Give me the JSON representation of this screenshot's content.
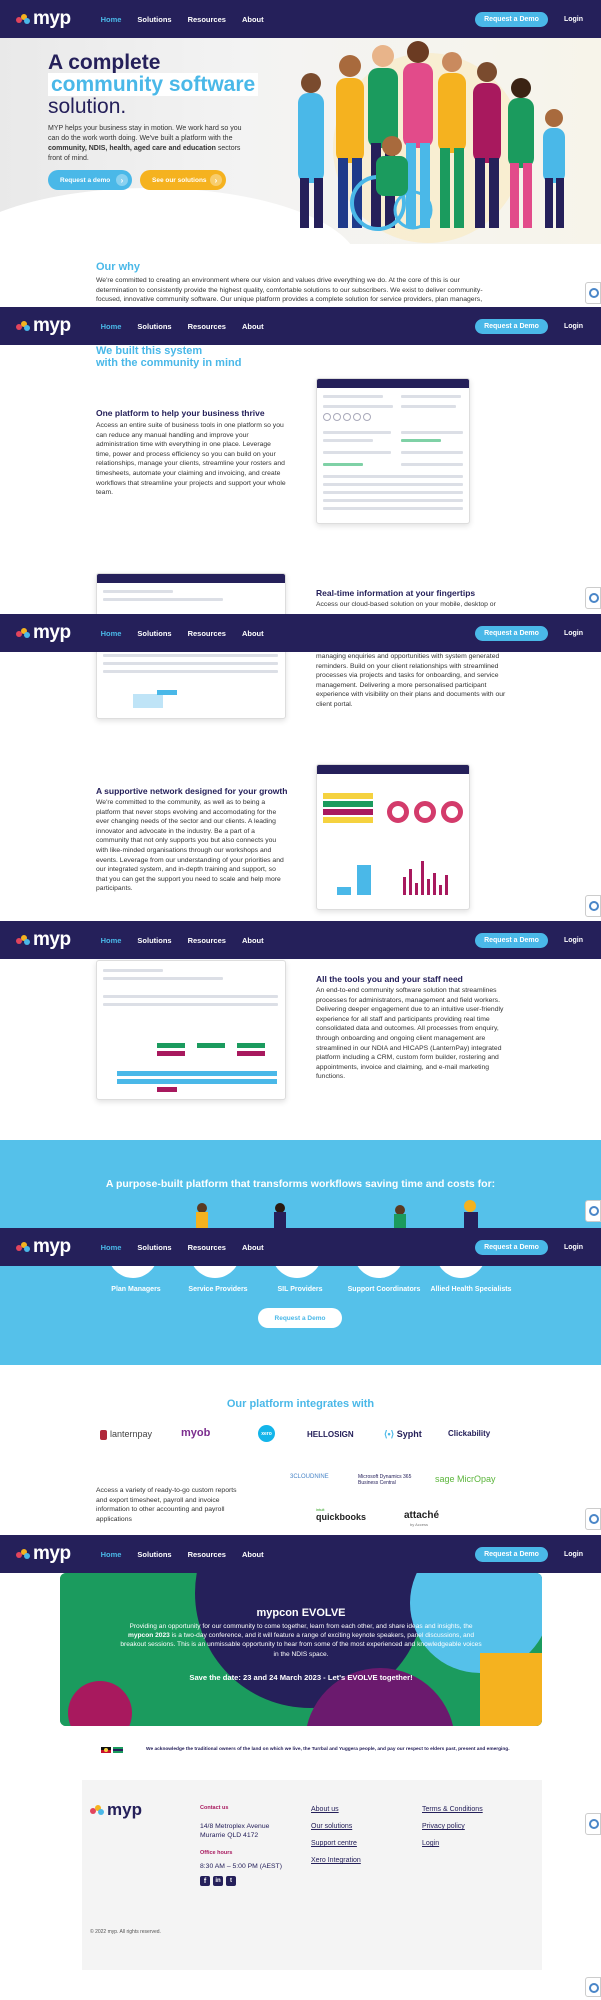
{
  "nav": {
    "brand": "myp",
    "links": [
      "Home",
      "Solutions",
      "Resources",
      "About"
    ],
    "demo_button": "Request a Demo",
    "login": "Login"
  },
  "hero": {
    "title_line1": "A complete",
    "title_highlight": "community software",
    "title_line3": "solution.",
    "desc_plain1": "MYP helps your business stay in motion. We work hard so you can do the work worth doing. We've built a platform with the ",
    "desc_bold": "community, NDIS, health, aged care and education",
    "desc_plain2": " sectors front of mind.",
    "btn_demo": "Request a demo",
    "btn_solutions": "See our solutions"
  },
  "why": {
    "title": "Our why",
    "text": "We're committed to creating an environment where our vision and values drive everything we do.  At the core of this is our determination to consistently provide the highest quality, comfortable solutions to our subscribers.  We exist to deliver community-focused, innovative community software.  Our unique platform provides a complete solution for service providers, plan managers,"
  },
  "built": {
    "title_line1": "We built this system",
    "title_line2": "with the community in mind"
  },
  "features": [
    {
      "title": "One platform to help your business thrive",
      "text": "Access an entire suite of business tools in one platform so you can reduce any manual handling and improve your administration time with everything in one place.  Leverage time, power and process efficiency so you can build on your relationships, manage your clients, streamline your rosters and timesheets, automate your claiming and invoicing, and create workflows that streamline your projects and support your whole team."
    },
    {
      "title": "Real-time information at your fingertips",
      "text_top": "Access our cloud-based solution on your mobile, desktop or",
      "text_bottom": "managing enquiries and opportunities with system generated reminders.  Build on your client relationships with streamlined processes via projects and tasks for onboarding, and service management.  Delivering a more personalised participant experience with visibility on their plans and documents with our client portal."
    },
    {
      "title": "A supportive network designed for your growth",
      "text": "We're committed to the community, as well as to being a platform that never stops evolving and accomodating for the ever changing needs of the sector and our clients.  A leading innovator and advocate in the industry.  Be a part of a community that not only supports you but also connects you with like-minded organisations through our workshops and events.  Leverage from our understanding of your priorities and our integrated system, and in-depth training and support, so that you can get the support you need to scale and help more participants."
    },
    {
      "title": "All the tools you and your staff need",
      "text": "An end-to-end community software solution that streamlines processes for administrators, management and field workers. Delivering deeper engagement due to an intuitive user-friendly experience for all staff and participants providing real time consolidated data and outcomes.  All processes from enquiry, through onboarding and ongoing client management are streamlined in our NDIA and HICAPS (LanternPay) integrated platform including a CRM, custom form builder, rostering and appointments, invoice and claiming, and e-mail marketing functions."
    }
  ],
  "purpose": {
    "title": "A purpose-built platform that transforms workflows saving time and costs for:",
    "audiences": [
      "Plan Managers",
      "Service Providers",
      "SIL Providers",
      "Support Coordinators",
      "Allied Health Specialists"
    ],
    "cta": "Request a Demo"
  },
  "integrations": {
    "title": "Our platform integrates with",
    "logos_row1": [
      "lanternpay",
      "myob",
      "xero",
      "HELLOSIGN",
      "Sypht",
      "Clickability"
    ],
    "logos_row2": [
      "3CLOUDNINE",
      "Microsoft Dynamics 365 Business Central",
      "sage MicrOpay"
    ],
    "logos_row3": [
      "quickbooks",
      "attaché"
    ],
    "logo_small": [
      "intuit",
      "by Access"
    ],
    "text": "Access a variety of ready-to-go custom reports and export timesheet, payroll and invoice information to other accounting and payroll applications"
  },
  "mypcon": {
    "title": "mypcon EVOLVE",
    "text_plain1": "Providing an opportunity for our community to come together, learn from each other, and share ideas and insights, the ",
    "text_bold": "mypcon 2023",
    "text_plain2": " is a two-day conference, and it will feature a range of exciting keynote speakers, panel discussions, and breakout sessions. This is an unmissable opportunity to hear from some of the most experienced and knowledgeable voices in the NDIS space.",
    "save_date": "Save the date: 23 and 24 March 2023 - Let's EVOLVE together!"
  },
  "acknowledgement": "We acknowledge the traditional owners of the land on which we live, the Turrbal and Yuggera people, and pay our respect to elders past, present and emerging.",
  "footer": {
    "brand": "myp",
    "contact_label": "Contact us",
    "address_line1": "14/8 Metroplex Avenue",
    "address_line2": "Murarrie QLD 4172",
    "hours_label": "Office hours",
    "hours": "8:30 AM – 5:00 PM (AEST)",
    "links_col1": [
      "About us",
      "Our solutions",
      "Support centre",
      "Xero Integration"
    ],
    "links_col2": [
      "Terms & Conditions",
      "Privacy policy",
      "Login"
    ],
    "copyright": "© 2022 myp.  All rights reserved."
  },
  "colors": {
    "navy": "#25205a",
    "accent_blue": "#4ab8e8",
    "orange": "#f5b21f",
    "magenta": "#a8195e",
    "green": "#1b9b5e"
  }
}
